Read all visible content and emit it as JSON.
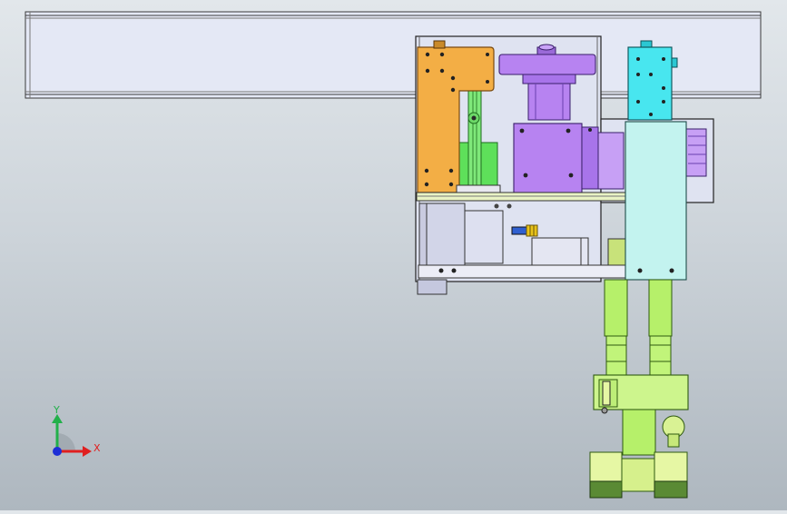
{
  "viewport": {
    "view": "front-orthographic"
  },
  "triad": {
    "x_label": "X",
    "y_label": "Y",
    "colors": {
      "x": "#e01f1f",
      "y": "#22b04a",
      "z": "#1d2fd6"
    }
  },
  "colors": {
    "rail": "#e4e8f5",
    "frame": "#dfe3f1",
    "orange_plate": "#f3ae45",
    "purple_motor": "#b783f1",
    "green_bracket": "#5ee05a",
    "cyan_block": "#48e6ef",
    "pale_cyan_panel": "#c3f3ef",
    "lime_arm": "#b6f06a",
    "lime_base": "#e6f7a4",
    "dark_green_foot": "#5a8a34",
    "blue_fitting": "#2f5fd0",
    "yellow_fitting": "#e8c31a"
  }
}
